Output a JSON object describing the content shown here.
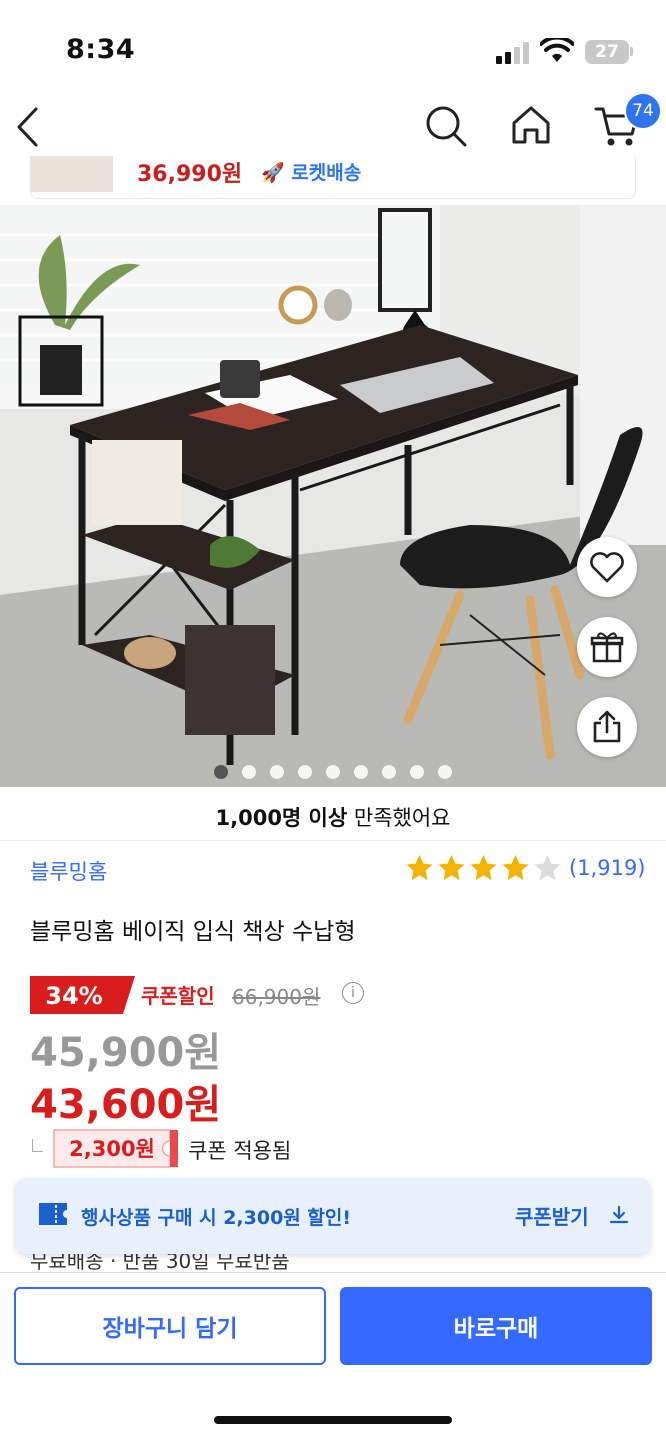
{
  "status": {
    "time": "8:34",
    "battery": "27"
  },
  "nav": {
    "cart_count": "74"
  },
  "mini_bar": {
    "price": "36,990원",
    "delivery": "로켓배송"
  },
  "gallery": {
    "image_count": 9,
    "active_index": 0
  },
  "review": {
    "count_bold": "1,000명 이상",
    "suffix": " 만족했어요"
  },
  "product": {
    "brand": "블루밍홈",
    "rating": 4,
    "rating_count": "(1,919)",
    "title": "블루밍홈 베이직 입식 책상 수납형",
    "discount": "34%",
    "coupon_label": "쿠폰할인",
    "original_price": "66,900원",
    "sale_price": "45,900원",
    "coupon_price": "43,600원",
    "coupon_amount": "2,300원",
    "coupon_applied": "쿠폰 적용됨",
    "features": "무료배송 · 반품 30일 무료반품"
  },
  "banner": {
    "text": "행사상품 구매 시 2,300원 할인!",
    "button": "쿠폰받기"
  },
  "actions": {
    "cart": "장바구니 담기",
    "buy": "바로구매"
  },
  "colors": {
    "accent": "#346aff",
    "price_red": "#d91c1c",
    "badge_blue": "#2d74ee"
  }
}
